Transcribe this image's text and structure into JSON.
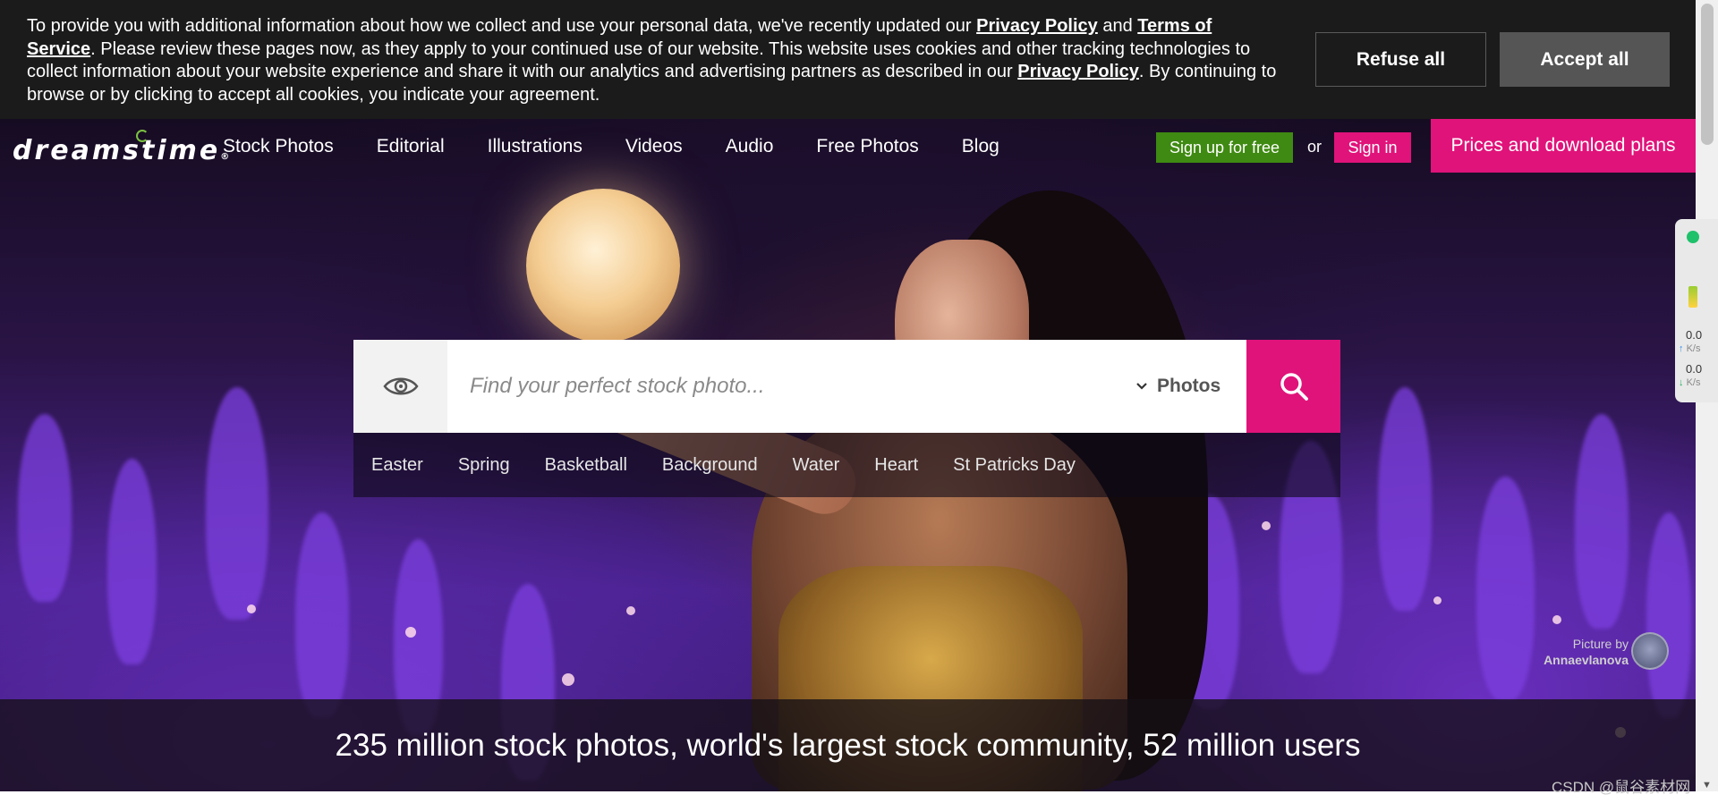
{
  "cookie": {
    "text_1": "To provide you with additional information about how we collect and use your personal data, we've recently updated our ",
    "privacy_link": "Privacy Policy",
    "text_and": " and ",
    "terms_link": "Terms of Service",
    "text_2": ". Please review these pages now, as they apply to your continued use of our website. This website uses cookies and other tracking technologies to collect information about your website experience and share it with our analytics and advertising partners as described in our ",
    "privacy_link_2": "Privacy Policy",
    "text_3": ". By continuing to browse or by clicking to accept all cookies, you indicate your agreement.",
    "refuse_label": "Refuse all",
    "accept_label": "Accept all"
  },
  "nav": {
    "logo": "dreamstime",
    "logo_reg": "®",
    "links": [
      "Stock Photos",
      "Editorial",
      "Illustrations",
      "Videos",
      "Audio",
      "Free Photos",
      "Blog"
    ],
    "signup_label": "Sign up for free",
    "or_label": "or",
    "signin_label": "Sign in",
    "prices_label": "Prices and download plans"
  },
  "search": {
    "placeholder": "Find your perfect stock photo...",
    "value": "",
    "type_selected": "Photos",
    "icons": {
      "visual_search": "eye-icon",
      "submit": "search-icon",
      "dropdown": "chevron-down-icon"
    }
  },
  "tags": [
    "Easter",
    "Spring",
    "Basketball",
    "Background",
    "Water",
    "Heart",
    "St Patricks Day"
  ],
  "credit": {
    "label": "Picture by",
    "author": "Annaevlanova"
  },
  "tagline": "235 million stock photos, world's largest stock community, 52 million users",
  "widget": {
    "up_value": "0.0",
    "up_unit": "K/s",
    "down_value": "0.0",
    "down_unit": "K/s"
  },
  "watermark": "CSDN @鼠谷素材网",
  "colors": {
    "brand_pink": "#e0137a",
    "signup_green": "#3f8a12",
    "cookie_bg": "#1b1b1b",
    "accept_bg": "#555555"
  }
}
